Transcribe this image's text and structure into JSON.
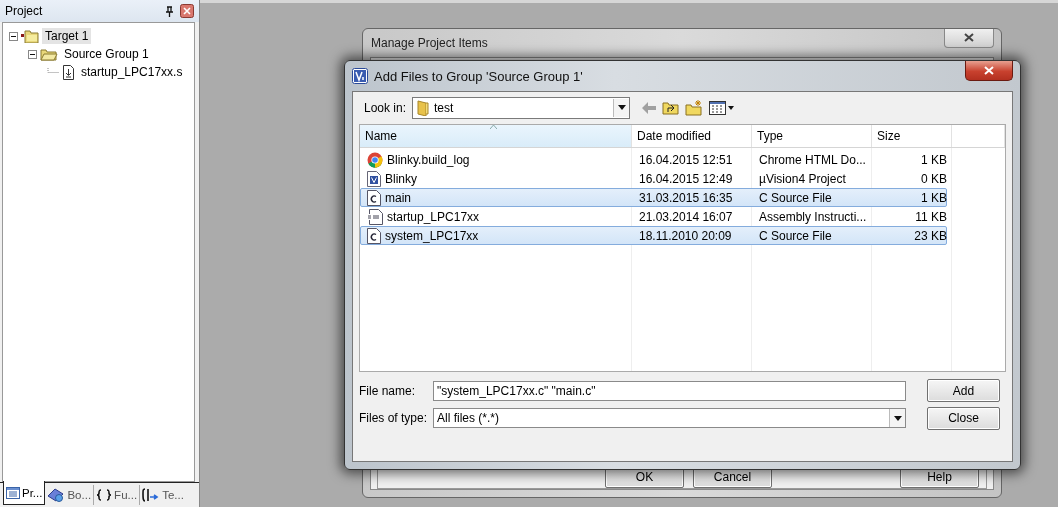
{
  "project_panel": {
    "title": "Project",
    "tree": [
      {
        "label": "Target 1",
        "kind": "target",
        "expanded": true,
        "selected": true,
        "children": [
          {
            "label": "Source Group 1",
            "kind": "folder",
            "expanded": true,
            "selected": false,
            "children": [
              {
                "label": "startup_LPC17xx.s",
                "kind": "file",
                "selected": false
              }
            ]
          }
        ]
      }
    ],
    "tabs": [
      {
        "label": "Pr...",
        "kind": "project",
        "selected": true
      },
      {
        "label": "Bo...",
        "kind": "books",
        "selected": false
      },
      {
        "label": "Fu...",
        "kind": "functions",
        "selected": false
      },
      {
        "label": "Te...",
        "kind": "templates",
        "selected": false
      }
    ]
  },
  "manage_dialog": {
    "title": "Manage Project Items",
    "buttons": [
      "OK",
      "Cancel",
      "Help"
    ]
  },
  "add_dialog": {
    "title": "Add Files to Group 'Source Group 1'",
    "look_in": {
      "label": "Look in:",
      "value": "test"
    },
    "columns": [
      {
        "label": "Name",
        "sorted": true
      },
      {
        "label": "Date modified",
        "sorted": false
      },
      {
        "label": "Type",
        "sorted": false
      },
      {
        "label": "Size",
        "sorted": false
      }
    ],
    "files": [
      {
        "name": "Blinky.build_log",
        "date": "16.04.2015 12:51",
        "type": "Chrome HTML Do...",
        "size": "1 KB",
        "kind": "chrome",
        "selected": false
      },
      {
        "name": "Blinky",
        "date": "16.04.2015 12:49",
        "type": "µVision4 Project",
        "size": "0 KB",
        "kind": "project",
        "selected": false
      },
      {
        "name": "main",
        "date": "31.03.2015 16:35",
        "type": "C Source File",
        "size": "1 KB",
        "kind": "c",
        "selected": true
      },
      {
        "name": "startup_LPC17xx",
        "date": "21.03.2014 16:07",
        "type": "Assembly Instructi...",
        "size": "11 KB",
        "kind": "asm",
        "selected": false
      },
      {
        "name": "system_LPC17xx",
        "date": "18.11.2010 20:09",
        "type": "C Source File",
        "size": "23 KB",
        "kind": "c",
        "selected": true
      }
    ],
    "file_name": {
      "label": "File name:",
      "value": "\"system_LPC17xx.c\" \"main.c\""
    },
    "file_type": {
      "label": "Files of type:",
      "value": "All files (*.*)"
    },
    "buttons": [
      "Add",
      "Close"
    ]
  }
}
